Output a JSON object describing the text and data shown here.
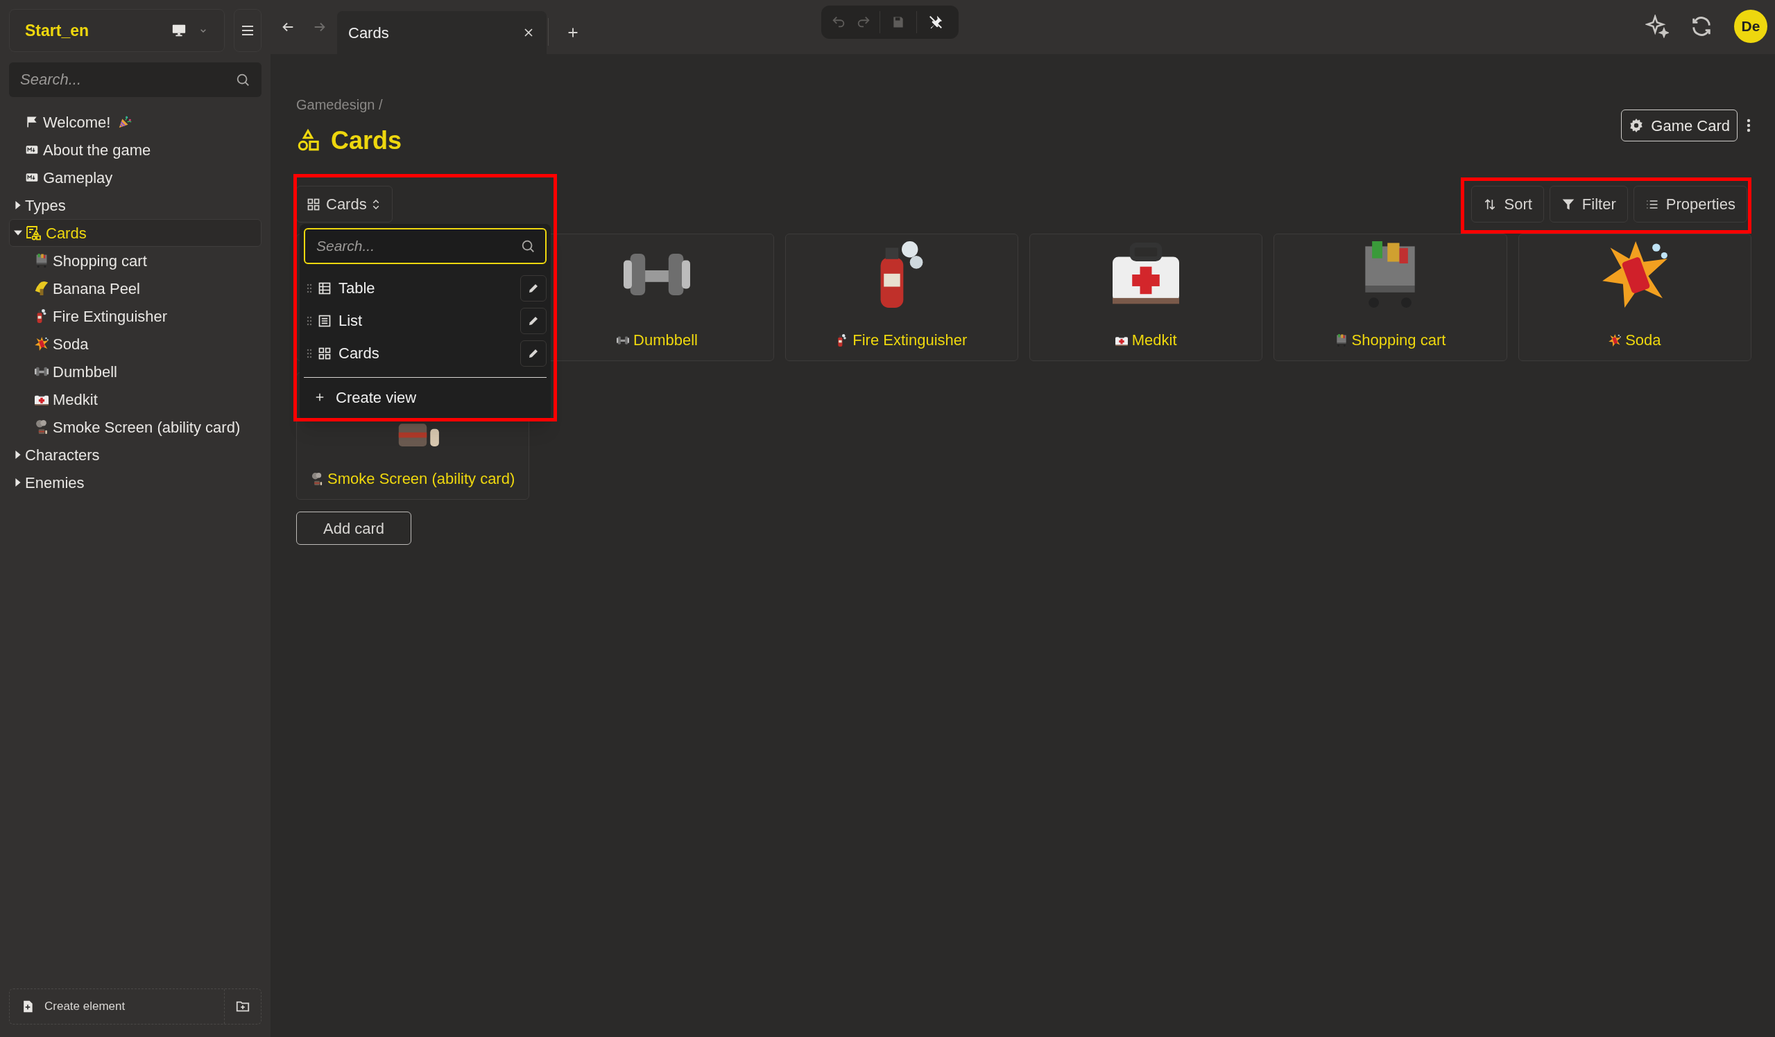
{
  "workspace": {
    "name": "Start_en"
  },
  "sidebar": {
    "search": {
      "placeholder": "Search..."
    },
    "items": [
      {
        "label": "Welcome!",
        "kind": "document",
        "selected": false
      },
      {
        "label": "About the game",
        "kind": "document",
        "selected": false
      },
      {
        "label": "Gameplay",
        "kind": "document",
        "selected": false
      },
      {
        "label": "Types",
        "kind": "folder",
        "expanded": false,
        "selected": false
      },
      {
        "label": "Cards",
        "kind": "collection",
        "expanded": true,
        "selected": true,
        "children": [
          {
            "label": "Shopping cart",
            "kind": "entry",
            "selected": false
          },
          {
            "label": "Banana Peel",
            "kind": "entry",
            "selected": false
          },
          {
            "label": "Fire Extinguisher",
            "kind": "entry",
            "selected": false
          },
          {
            "label": "Soda",
            "kind": "entry",
            "selected": false
          },
          {
            "label": "Dumbbell",
            "kind": "entry",
            "selected": false
          },
          {
            "label": "Medkit",
            "kind": "entry",
            "selected": false
          },
          {
            "label": "Smoke Screen (ability card)",
            "kind": "entry",
            "selected": false
          }
        ]
      },
      {
        "label": "Characters",
        "kind": "folder",
        "expanded": false,
        "selected": false
      },
      {
        "label": "Enemies",
        "kind": "folder",
        "expanded": false,
        "selected": false
      }
    ],
    "footer": {
      "create_label": "Create element"
    }
  },
  "tabs": [
    {
      "label": "Cards",
      "selected": true
    }
  ],
  "user": {
    "initials": "De"
  },
  "page": {
    "breadcrumb": "Gamedesign /",
    "title": "Cards",
    "type_button": "Game Card",
    "view_button": "Cards",
    "actions": [
      {
        "label": "Sort",
        "kind": "sort"
      },
      {
        "label": "Filter",
        "kind": "filter"
      },
      {
        "label": "Properties",
        "kind": "properties"
      }
    ]
  },
  "view_menu": {
    "search": {
      "placeholder": "Search..."
    },
    "views": [
      {
        "label": "Table",
        "kind": "table"
      },
      {
        "label": "List",
        "kind": "list"
      },
      {
        "label": "Cards",
        "kind": "cards"
      }
    ],
    "create_label": "Create view"
  },
  "cards": [
    {
      "kind": "covered"
    },
    {
      "kind": "item",
      "title": "Dumbbell"
    },
    {
      "kind": "item",
      "title": "Fire Extinguisher"
    },
    {
      "kind": "item",
      "title": "Medkit"
    },
    {
      "kind": "item",
      "title": "Shopping cart"
    },
    {
      "kind": "item",
      "title": "Soda"
    },
    {
      "kind": "item",
      "title": "Smoke Screen (ability card)"
    }
  ],
  "add_card": "Add card"
}
